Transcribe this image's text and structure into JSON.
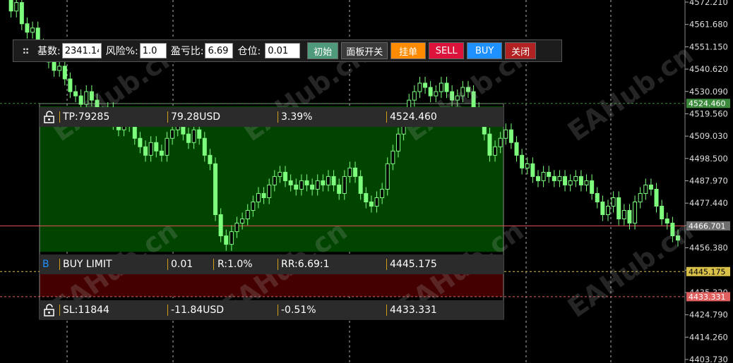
{
  "toolbar": {
    "base_label": "基数:",
    "base_value": "2341.14",
    "risk_label": "风险%:",
    "risk_value": "1.0",
    "rr_label": "盈亏比:",
    "rr_value": "6.69",
    "pos_label": "仓位:",
    "pos_value": "0.01",
    "btn_init": "初始",
    "btn_panel": "面板开关",
    "btn_pending": "挂单",
    "btn_sell": "SELL",
    "btn_buy": "BUY",
    "btn_close": "关闭",
    "colors": {
      "init": "#4f9a7a",
      "panel": "#3a3a3a",
      "pending": "#ff8c00",
      "sell": "#dc143c",
      "buy": "#1e90ff",
      "close": "#b22222"
    }
  },
  "trade_panel": {
    "tp_row": {
      "label": "TP:79285",
      "usd": "79.28USD",
      "pct": "3.39%",
      "price": "4524.460"
    },
    "entry_row": {
      "marker": "B",
      "label": "BUY LIMIT",
      "lots": "0.01",
      "risk": "R:1.0%",
      "rr": "RR:6.69:1",
      "price": "4445.175"
    },
    "sl_row": {
      "label": "SL:11844",
      "usd": "-11.84USD",
      "pct": "-0.51%",
      "price": "4433.331"
    }
  },
  "price_axis": {
    "ticks": [
      "4572.210",
      "4561.680",
      "4551.150",
      "4540.620",
      "4530.090",
      "4519.560",
      "4509.030",
      "4498.500",
      "4487.970",
      "4477.440",
      "4466.910",
      "4456.380",
      "4445.850",
      "4435.320",
      "4424.790",
      "4414.260",
      "4403.730"
    ],
    "tags": [
      {
        "text": "4524.460",
        "color": "#3c8a3c",
        "value": 4524.46
      },
      {
        "text": "4466.701",
        "color": "#6e6e6e",
        "value": 4466.701
      },
      {
        "text": "4445.175",
        "color": "#d9c14a",
        "value": 4445.175
      },
      {
        "text": "4433.331",
        "color": "#e06060",
        "value": 4433.331
      }
    ]
  },
  "watermark": "EAHub.cn"
}
